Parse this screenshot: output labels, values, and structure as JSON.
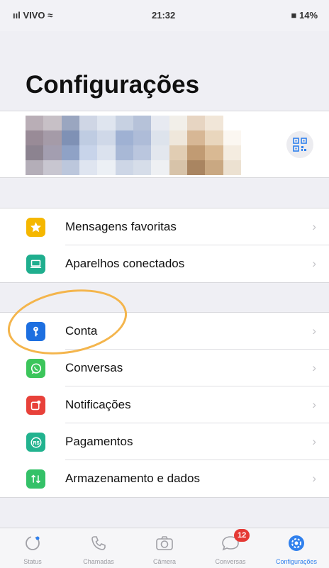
{
  "status_bar": {
    "carrier": "ııl VIVO ≈",
    "time": "21:32",
    "battery": "■ 14%"
  },
  "page_title": "Configurações",
  "profile": {
    "qr_icon": "qr-code-icon"
  },
  "sections": [
    {
      "rows": [
        {
          "label": "Mensagens favoritas",
          "icon": "star-icon",
          "color": "#f5b700"
        },
        {
          "label": "Aparelhos conectados",
          "icon": "laptop-icon",
          "color": "#1fae8e"
        }
      ]
    },
    {
      "rows": [
        {
          "label": "Conta",
          "icon": "key-icon",
          "color": "#1d6fe0"
        },
        {
          "label": "Conversas",
          "icon": "whatsapp-icon",
          "color": "#3cc55b"
        },
        {
          "label": "Notificações",
          "icon": "notification-icon",
          "color": "#e8413a"
        },
        {
          "label": "Pagamentos",
          "icon": "rs-icon",
          "color": "#22b38f"
        },
        {
          "label": "Armazenamento e dados",
          "icon": "arrows-updown-icon",
          "color": "#34c168"
        }
      ]
    }
  ],
  "chevron": "›",
  "tab_bar": {
    "tabs": [
      {
        "label": "Status",
        "icon": "status-icon"
      },
      {
        "label": "Chamadas",
        "icon": "phone-icon"
      },
      {
        "label": "Câmera",
        "icon": "camera-icon"
      },
      {
        "label": "Conversas",
        "icon": "chat-icon",
        "badge": "12"
      },
      {
        "label": "Configurações",
        "icon": "settings-icon",
        "active": true
      }
    ]
  },
  "colors": {
    "accent": "#2f80ed",
    "highlight": "#f4b54c",
    "badge": "#e53935"
  }
}
